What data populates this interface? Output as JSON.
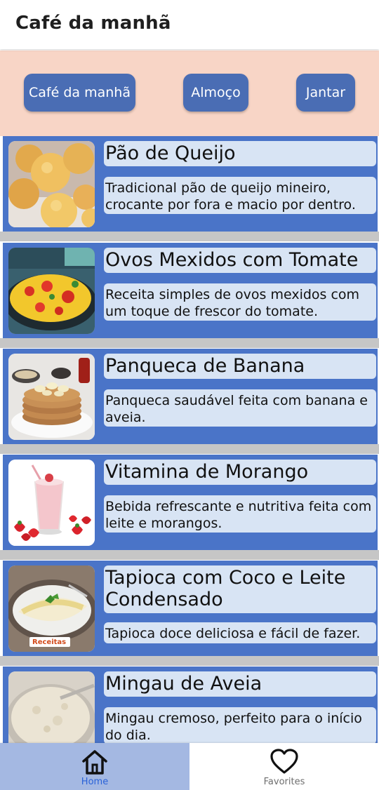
{
  "app_bar": {
    "title": "Café da manhã"
  },
  "categories": [
    {
      "label": "Café da manhã"
    },
    {
      "label": "Almoço"
    },
    {
      "label": "Jantar"
    }
  ],
  "recipes": [
    {
      "title": "Pão de Queijo",
      "description": "Tradicional pão de queijo mineiro, crocante por fora e macio por dentro.",
      "image_icon": "cheese-bread-image"
    },
    {
      "title": "Ovos Mexidos com Tomate",
      "description": "Receita simples de ovos mexidos com um toque de frescor do tomate.",
      "image_icon": "scrambled-eggs-image"
    },
    {
      "title": "Panqueca de Banana",
      "description": "Panqueca saudável feita com banana e aveia.",
      "image_icon": "banana-pancake-image"
    },
    {
      "title": "Vitamina de Morango",
      "description": "Bebida refrescante e nutritiva feita com leite e morangos.",
      "image_icon": "strawberry-smoothie-image"
    },
    {
      "title": "Tapioca com Coco e Leite Condensado",
      "description": "Tapioca doce deliciosa e fácil de fazer.",
      "image_icon": "tapioca-image",
      "image_watermark": "Receitas"
    },
    {
      "title": "Mingau de Aveia",
      "description": "Mingau cremoso, perfeito para o início do dia.",
      "image_icon": "oatmeal-porridge-image"
    }
  ],
  "bottom_nav": {
    "items": [
      {
        "label": "Home",
        "icon": "home-icon",
        "selected": true
      },
      {
        "label": "Favorites",
        "icon": "heart-icon",
        "selected": false
      }
    ]
  },
  "colors": {
    "accent": "#4a6db4",
    "card_background": "#4a74c8",
    "category_bar": "#f8d5c6",
    "text_box": "#d8e4f4",
    "nav_selected": "#a4b8e2",
    "nav_selected_label": "#2a62d8"
  }
}
